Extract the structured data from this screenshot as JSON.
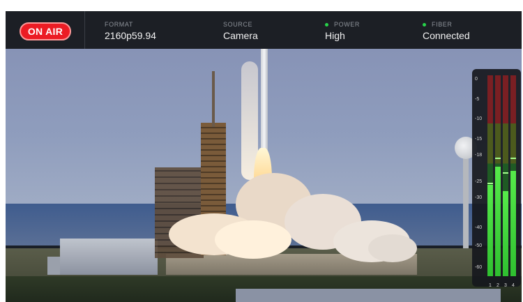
{
  "status_bar": {
    "on_air": "ON AIR",
    "format": {
      "label": "FORMAT",
      "value": "2160p59.94"
    },
    "source": {
      "label": "SOURCE",
      "value": "Camera"
    },
    "power": {
      "label": "POWER",
      "value": "High",
      "indicator_color": "#27d34a"
    },
    "fiber": {
      "label": "FIBER",
      "value": "Connected",
      "indicator_color": "#27d34a"
    }
  },
  "video": {
    "content": "rocket-launch-scene"
  },
  "audio_meter": {
    "scale": [
      "0",
      "-5",
      "-10",
      "-15",
      "-18",
      "-25",
      "-30",
      "-40",
      "-50",
      "-60"
    ],
    "channels": [
      {
        "label": "1",
        "level_db": -26,
        "peak_db": -26
      },
      {
        "label": "2",
        "level_db": -21,
        "peak_db": -19
      },
      {
        "label": "3",
        "level_db": -28,
        "peak_db": -23
      },
      {
        "label": "4",
        "level_db": -22,
        "peak_db": -19
      }
    ],
    "colors": {
      "green": "#3bd43a",
      "yellow": "#4c5a1d",
      "red": "#7a1f23"
    }
  },
  "colors": {
    "on_air_red": "#ec1c24",
    "bar_bg": "#1c1f25"
  }
}
